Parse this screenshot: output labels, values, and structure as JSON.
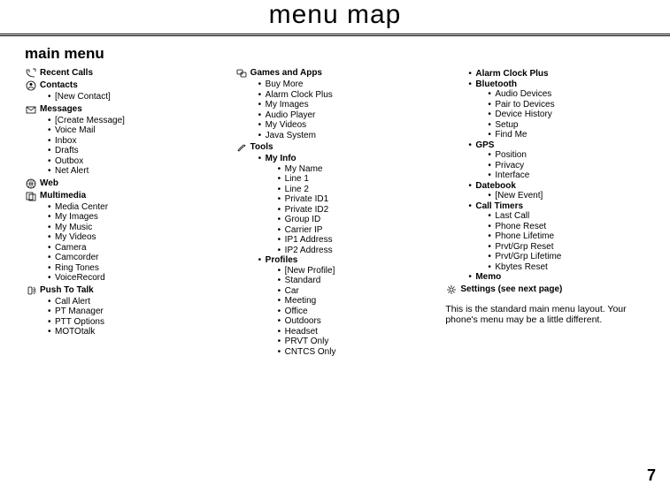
{
  "title": "menu map",
  "section": "main menu",
  "page_number": "7",
  "note": "This is the standard main menu layout. Your phone's menu may be a little different.",
  "col1": {
    "recent_calls": {
      "title": "Recent Calls"
    },
    "contacts": {
      "title": "Contacts",
      "items": [
        "[New Contact]"
      ]
    },
    "messages": {
      "title": "Messages",
      "items": [
        "[Create Message]",
        "Voice Mail",
        "Inbox",
        "Drafts",
        "Outbox",
        "Net Alert"
      ]
    },
    "web": {
      "title": "Web"
    },
    "multimedia": {
      "title": "Multimedia",
      "items": [
        "Media Center",
        "My Images",
        "My Music",
        "My Videos",
        "Camera",
        "Camcorder",
        "Ring Tones",
        "VoiceRecord"
      ]
    },
    "ptt": {
      "title": "Push To Talk",
      "items": [
        "Call Alert",
        "PT Manager",
        "PTT Options",
        "MOTOtalk"
      ]
    }
  },
  "col2": {
    "games": {
      "title": "Games and Apps",
      "items": [
        "Buy More",
        "Alarm Clock Plus",
        "My Images",
        "Audio Player",
        "My Videos",
        "Java System"
      ]
    },
    "tools": {
      "title": "Tools",
      "myinfo": {
        "title": "My Info",
        "items": [
          "My Name",
          "Line 1",
          "Line 2",
          "Private ID1",
          "Private ID2",
          "Group ID",
          "Carrier IP",
          "IP1 Address",
          "IP2 Address"
        ]
      },
      "profiles": {
        "title": "Profiles",
        "items": [
          "[New Profile]",
          "Standard",
          "Car",
          "Meeting",
          "Office",
          "Outdoors",
          "Headset",
          "PRVT Only",
          "CNTCS Only"
        ]
      }
    }
  },
  "col3": {
    "alarm": {
      "title": "Alarm Clock Plus"
    },
    "bluetooth": {
      "title": "Bluetooth",
      "items": [
        "Audio Devices",
        "Pair to Devices",
        "Device History",
        "Setup",
        "Find Me"
      ]
    },
    "gps": {
      "title": "GPS",
      "items": [
        "Position",
        "Privacy",
        "Interface"
      ]
    },
    "datebook": {
      "title": "Datebook",
      "items": [
        "[New Event]"
      ]
    },
    "calltimers": {
      "title": "Call Timers",
      "items": [
        "Last Call",
        "Phone Reset",
        "Phone Lifetime",
        "Prvt/Grp Reset",
        "Prvt/Grp Lifetime",
        "Kbytes Reset"
      ]
    },
    "memo": {
      "title": "Memo"
    },
    "settings": {
      "title": "Settings (see next page)"
    }
  }
}
